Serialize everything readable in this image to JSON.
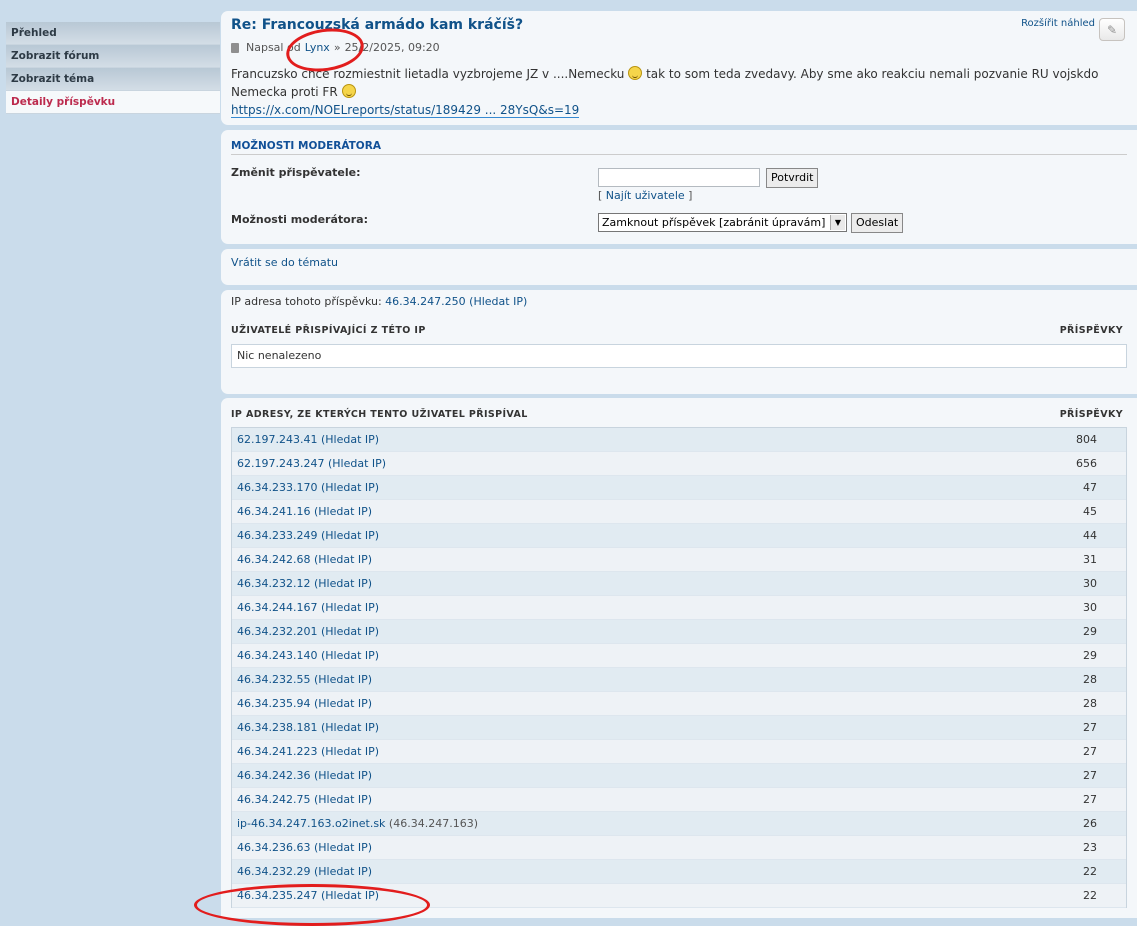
{
  "sidebar": {
    "items": [
      {
        "label": "Přehled"
      },
      {
        "label": "Zobrazit fórum"
      },
      {
        "label": "Zobrazit téma"
      },
      {
        "label": "Detaily příspěvku"
      }
    ]
  },
  "post": {
    "title": "Re: Francouzská armádo kam kráčíš?",
    "meta_prefix": "Napsal od",
    "author": "Lynx",
    "meta_sep": "»",
    "date": "25/2/2025, 09:20",
    "expand_label": "Rozšířit náhled",
    "body_part1": "Francuzsko chce rozmiestnit lietadla vyzbrojeme JZ v ....Nemecku",
    "body_part2": "tak to som teda zvedavy. Aby sme ako reakciu nemali pozvanie RU vojskdo Nemecka proti FR",
    "link": "https://x.com/NOELreports/status/189429 ... 28YsQ&s=19"
  },
  "moderator": {
    "header": "MOŽNOSTI MODERÁTORA",
    "change_poster_label": "Změnit přispěvatele:",
    "confirm_button": "Potvrdit",
    "find_user_open": "[",
    "find_user": "Najít uživatele",
    "find_user_close": "]",
    "options_label": "Možnosti moderátora:",
    "options_selected": "Zamknout příspěvek [zabránit úpravám]",
    "send_button": "Odeslat"
  },
  "back": {
    "label": "Vrátit se do tématu"
  },
  "ip_info": {
    "prefix": "IP adresa tohoto příspěvku:",
    "ip": "46.34.247.250",
    "search": "(Hledat IP)",
    "users_header": "UŽIVATELÉ PŘISPÍVAJÍCÍ Z TÉTO IP",
    "posts_header": "PŘÍSPĚVKY",
    "empty": "Nic nenalezeno"
  },
  "ip_list": {
    "header": "IP ADRESY, ZE KTERÝCH TENTO UŽIVATEL PŘISPÍVAL",
    "posts_header": "PŘÍSPĚVKY",
    "rows": [
      {
        "ip": "62.197.243.41 (Hledat IP)",
        "count": "804"
      },
      {
        "ip": "62.197.243.247 (Hledat IP)",
        "count": "656"
      },
      {
        "ip": "46.34.233.170 (Hledat IP)",
        "count": "47"
      },
      {
        "ip": "46.34.241.16 (Hledat IP)",
        "count": "45"
      },
      {
        "ip": "46.34.233.249 (Hledat IP)",
        "count": "44"
      },
      {
        "ip": "46.34.242.68 (Hledat IP)",
        "count": "31"
      },
      {
        "ip": "46.34.232.12 (Hledat IP)",
        "count": "30"
      },
      {
        "ip": "46.34.244.167 (Hledat IP)",
        "count": "30"
      },
      {
        "ip": "46.34.232.201 (Hledat IP)",
        "count": "29"
      },
      {
        "ip": "46.34.243.140 (Hledat IP)",
        "count": "29"
      },
      {
        "ip": "46.34.232.55 (Hledat IP)",
        "count": "28"
      },
      {
        "ip": "46.34.235.94 (Hledat IP)",
        "count": "28"
      },
      {
        "ip": "46.34.238.181 (Hledat IP)",
        "count": "27"
      },
      {
        "ip": "46.34.241.223 (Hledat IP)",
        "count": "27"
      },
      {
        "ip": "46.34.242.36 (Hledat IP)",
        "count": "27"
      },
      {
        "ip": "46.34.242.75 (Hledat IP)",
        "count": "27"
      },
      {
        "ip": "ip-46.34.247.163.o2inet.sk",
        "ip_paren": "(46.34.247.163)",
        "count": "26"
      },
      {
        "ip": "46.34.236.63 (Hledat IP)",
        "count": "23"
      },
      {
        "ip": "46.34.232.29 (Hledat IP)",
        "count": "22"
      },
      {
        "ip": "46.34.235.247 (Hledat IP)",
        "count": "22"
      }
    ]
  },
  "colors": {
    "link": "#105289",
    "active": "#bc2a4d",
    "annotation": "#e21d1d"
  },
  "icons": {
    "post": "document-icon",
    "edit": "pencil-icon",
    "smiley": "smiley-icon"
  }
}
